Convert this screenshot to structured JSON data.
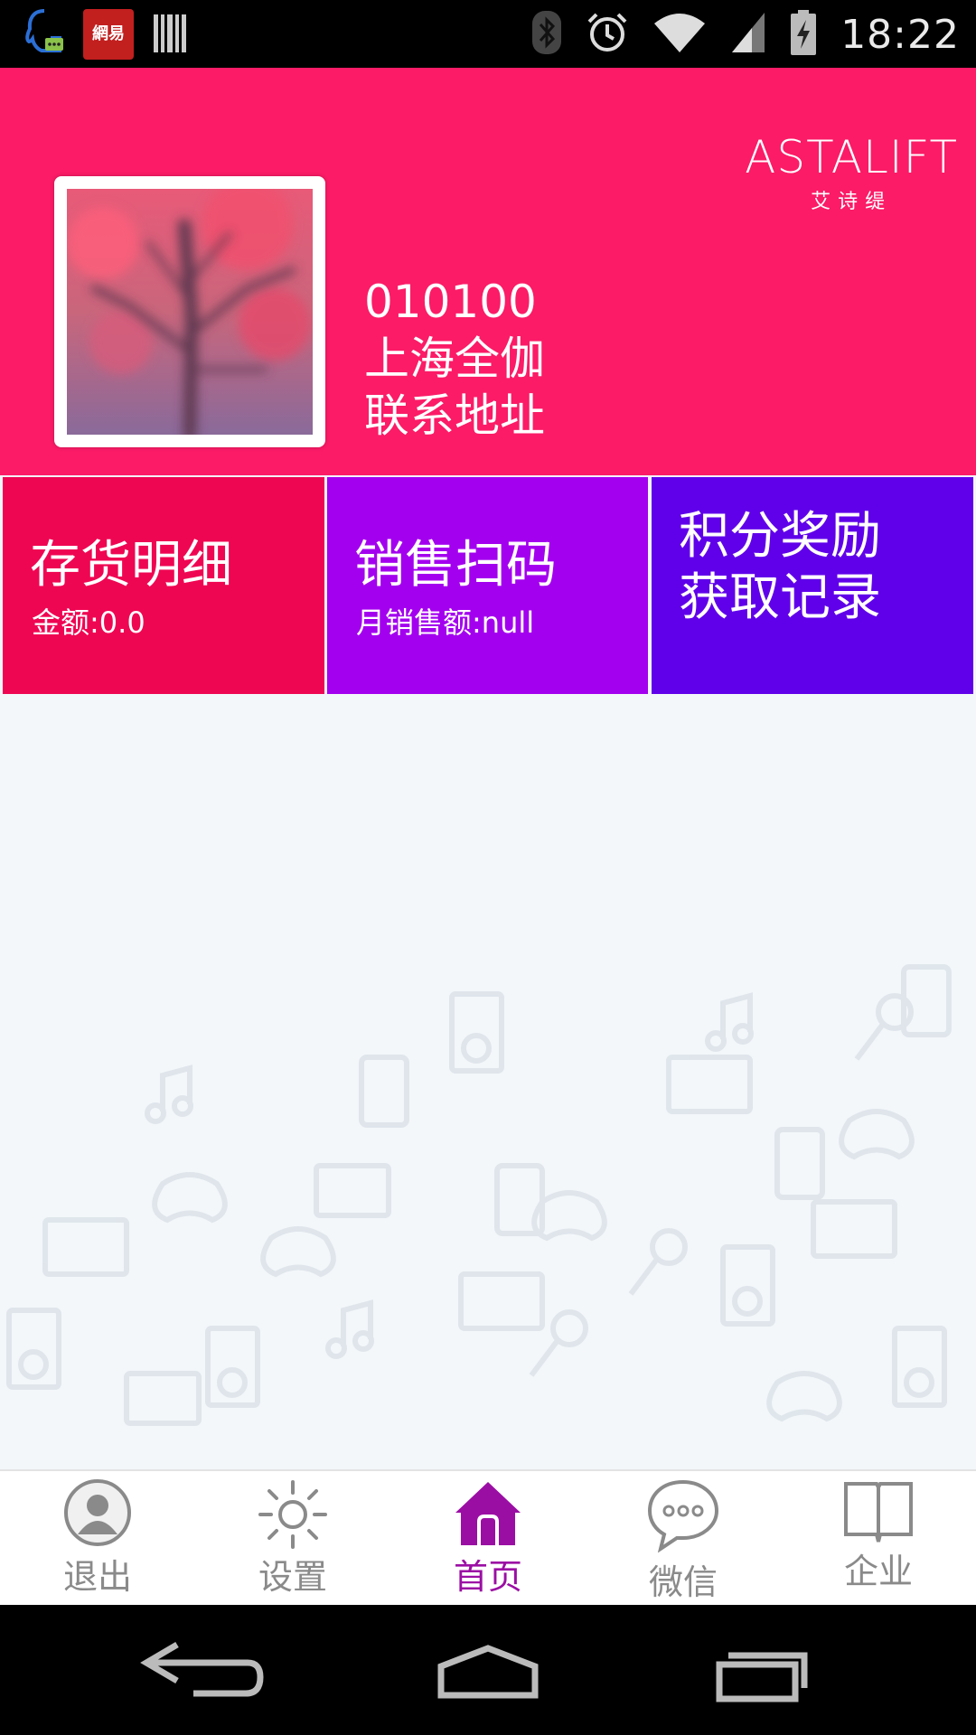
{
  "status_bar": {
    "time": "18:22",
    "netease_label": "網易",
    "icons": [
      "qq-icon",
      "netease-app-icon",
      "barcode-icon",
      "bluetooth-icon",
      "alarm-icon",
      "wifi-icon",
      "signal-icon",
      "battery-charging-icon"
    ]
  },
  "header": {
    "brand_name": "ASTALIFT",
    "brand_sub": "艾诗缇",
    "code": "010100",
    "store_name": "上海全伽",
    "address": "联系地址",
    "background_color": "#fb1b67"
  },
  "tiles": [
    {
      "title": "存货明细",
      "subtitle": "金额:0.0",
      "color": "#ef0653"
    },
    {
      "title": "销售扫码",
      "subtitle": "月销售额:null",
      "color": "#a300ef"
    },
    {
      "title_line1": "积分奖励",
      "title_line2": "获取记录",
      "color": "#6000ea"
    }
  ],
  "bottom_nav": [
    {
      "label": "退出",
      "icon": "user-icon",
      "active": false
    },
    {
      "label": "设置",
      "icon": "sun-settings-icon",
      "active": false
    },
    {
      "label": "首页",
      "icon": "home-icon",
      "active": true
    },
    {
      "label": "微信",
      "icon": "chat-bubble-icon",
      "active": false
    },
    {
      "label": "企业",
      "icon": "book-icon",
      "active": false
    }
  ],
  "colors": {
    "active_nav": "#9b0ea4",
    "inactive_nav": "#8a8a8a"
  }
}
